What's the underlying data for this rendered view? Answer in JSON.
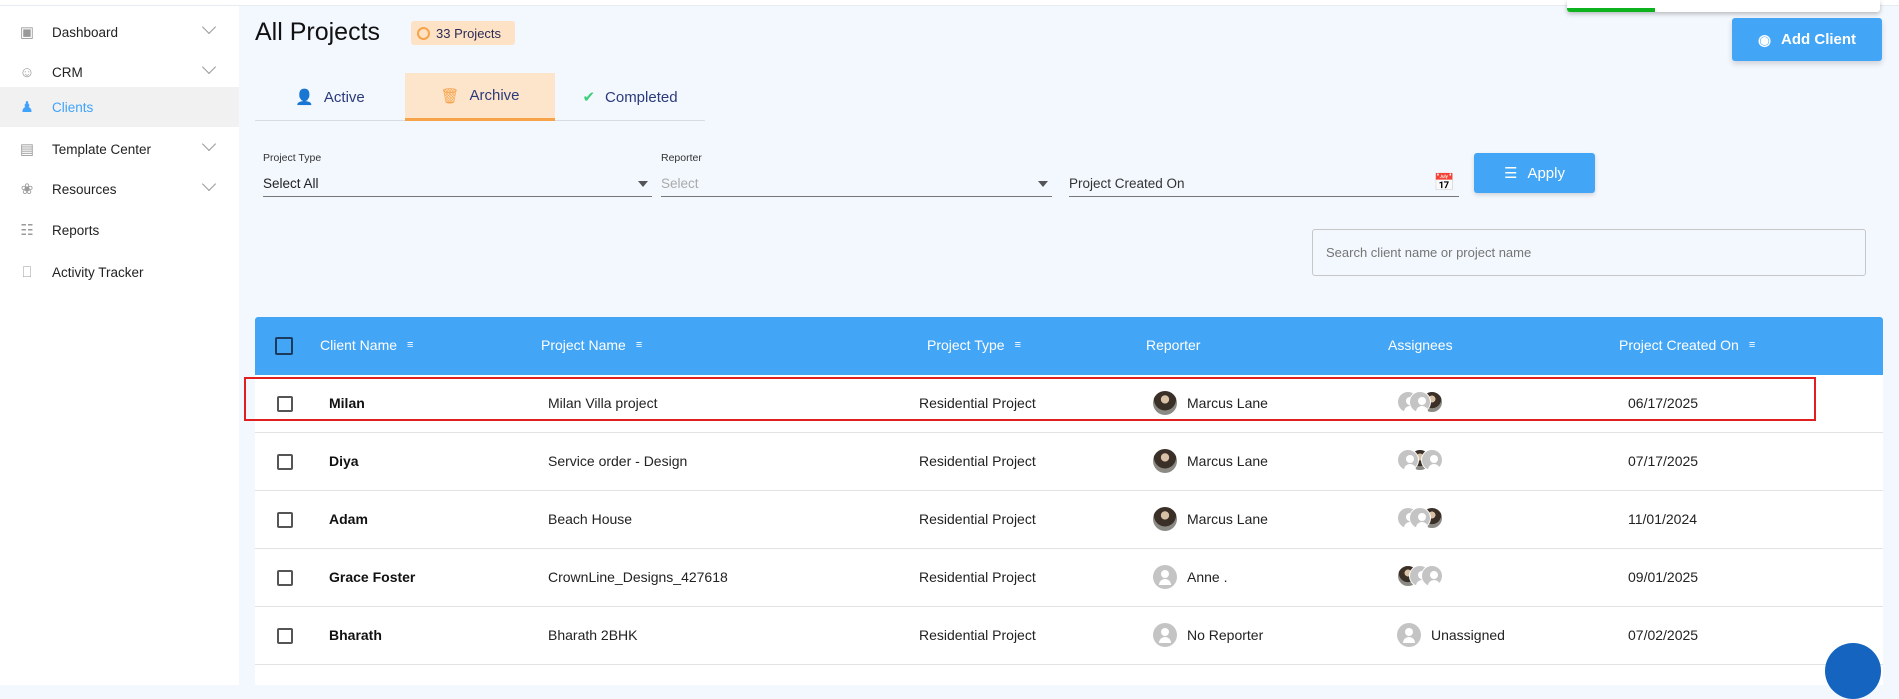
{
  "sidebar": {
    "items": [
      {
        "label": "Dashboard",
        "icon": "dashboard-icon",
        "chevron": true
      },
      {
        "label": "CRM",
        "icon": "crm-icon",
        "chevron": true
      },
      {
        "label": "Clients",
        "icon": "clients-icon",
        "chevron": false,
        "active": true
      },
      {
        "label": "Template Center",
        "icon": "template-icon",
        "chevron": true
      },
      {
        "label": "Resources",
        "icon": "resources-icon",
        "chevron": true
      },
      {
        "label": "Reports",
        "icon": "reports-icon",
        "chevron": false
      },
      {
        "label": "Activity Tracker",
        "icon": "activity-icon",
        "chevron": false
      }
    ]
  },
  "header": {
    "title": "All Projects",
    "count_badge": "33 Projects",
    "add_client": "Add Client"
  },
  "toast": {
    "progress": 0.28
  },
  "tabs": [
    {
      "label": "Active"
    },
    {
      "label": "Archive",
      "selected": true
    },
    {
      "label": "Completed"
    }
  ],
  "filters": {
    "project_type": {
      "label": "Project Type",
      "value": "Select All"
    },
    "reporter": {
      "label": "Reporter",
      "placeholder": "Select"
    },
    "created_on": {
      "placeholder": "Project Created On"
    },
    "apply": "Apply"
  },
  "search": {
    "placeholder": "Search client name or project name"
  },
  "table": {
    "columns": [
      "Client Name",
      "Project Name",
      "Project Type",
      "Reporter",
      "Assignees",
      "Project Created On"
    ],
    "rows": [
      {
        "client": "Milan",
        "project": "Milan Villa project",
        "type": "Residential Project",
        "reporter": "Marcus Lane",
        "reporter_photo": true,
        "assignees": [
          "blank",
          "blank",
          "photo"
        ],
        "date": "06/17/2025"
      },
      {
        "client": "Diya",
        "project": "Service order - Design",
        "type": "Residential Project",
        "reporter": "Marcus Lane",
        "reporter_photo": true,
        "assignees": [
          "blank",
          "photo",
          "blank"
        ],
        "date": "07/17/2025"
      },
      {
        "client": "Adam",
        "project": "Beach House",
        "type": "Residential Project",
        "reporter": "Marcus Lane",
        "reporter_photo": true,
        "assignees": [
          "blank",
          "blank",
          "photo"
        ],
        "date": "11/01/2024"
      },
      {
        "client": "Grace Foster",
        "project": "CrownLine_Designs_427618",
        "type": "Residential Project",
        "reporter": "Anne .",
        "reporter_photo": false,
        "assignees": [
          "photo",
          "blank",
          "blank"
        ],
        "date": "09/01/2025"
      },
      {
        "client": "Bharath",
        "project": "Bharath 2BHK",
        "type": "Residential Project",
        "reporter": "No Reporter",
        "reporter_photo": false,
        "assignees_label": "Unassigned",
        "date": "07/02/2025"
      }
    ]
  }
}
